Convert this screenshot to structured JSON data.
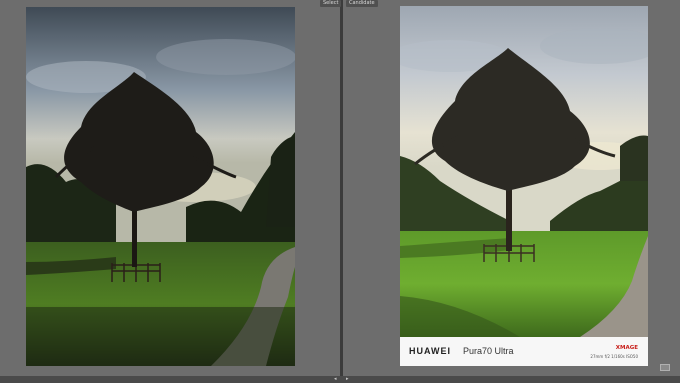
{
  "tags": {
    "select": "Select",
    "candidate": "Candidate"
  },
  "left_photo": {
    "description_icon": "tree-landscape-photo"
  },
  "right_photo": {
    "description_icon": "tree-landscape-photo"
  },
  "watermark": {
    "brand": "HUAWEI",
    "model": "Pura70 Ultra",
    "xmage": "XMAGE",
    "specs": "27mm  f/2  1/160s  ISO50"
  },
  "status": {
    "left_arrow": "◂",
    "right_arrow": "▸"
  },
  "colors": {
    "background": "#6d6d6d",
    "frame": "#f7f7f7",
    "xmage_red": "#c8201c"
  }
}
